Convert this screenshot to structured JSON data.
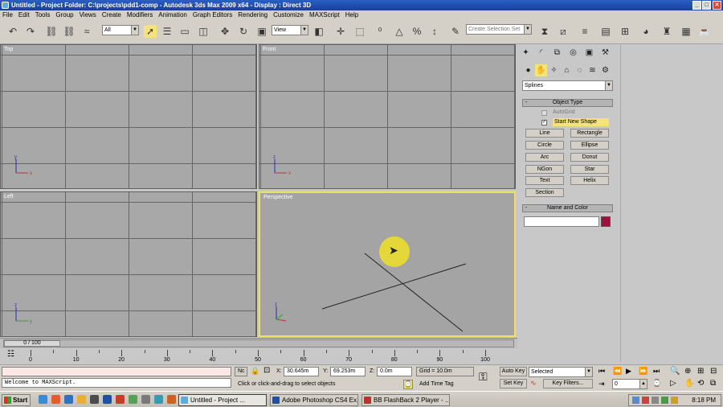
{
  "window": {
    "title": "Untitled    - Project Folder: C:\\projects\\pdd1-comp     - Autodesk 3ds Max  2009 x64     - Display : Direct 3D",
    "min": "_",
    "max": "□",
    "close": "✕"
  },
  "menu": [
    "File",
    "Edit",
    "Tools",
    "Group",
    "Views",
    "Create",
    "Modifiers",
    "Animation",
    "Graph Editors",
    "Rendering",
    "Customize",
    "MAXScript",
    "Help"
  ],
  "toolbar": {
    "filter_select": "All",
    "ref_coord": "View",
    "selection_set_placeholder": "Create Selection Set"
  },
  "viewports": {
    "top": "Top",
    "front": "Front",
    "left": "Left",
    "perspective": "Perspective",
    "axis_x": "x",
    "axis_y": "y",
    "axis_z": "z"
  },
  "command_panel": {
    "category_select": "Splines",
    "object_type_title": "Object Type",
    "autogrid_label": "AutoGrid",
    "start_new_shape_label": "Start New Shape",
    "buttons": [
      "Line",
      "Rectangle",
      "Circle",
      "Ellipse",
      "Arc",
      "Donut",
      "NGon",
      "Star",
      "Text",
      "Helix",
      "Section"
    ],
    "name_color_title": "Name and Color",
    "color": "#a0103c",
    "minus": "-"
  },
  "timeline": {
    "frame_counter": "0 / 100",
    "ticks": [
      "0",
      "10",
      "20",
      "30",
      "40",
      "50",
      "60",
      "70",
      "80",
      "90",
      "100"
    ]
  },
  "status": {
    "maxscript": "Welcome to MAXScript.",
    "hint": "Click or click-and-drag to select objects",
    "none_selected": "Nc",
    "x_label": "X:",
    "x_value": "30.645m",
    "y_label": "Y:",
    "y_value": "69.253m",
    "z_label": "Z:",
    "z_value": "0.0m",
    "grid": "Grid = 10.0m",
    "add_time_tag": "Add Time Tag",
    "auto_key": "Auto Key",
    "set_key": "Set Key",
    "selected_select": "Selected",
    "key_filters": "Key Filters...",
    "frame_field": "0"
  },
  "taskbar": {
    "start": "Start",
    "tasks": [
      "Untitled    - Project ...",
      "Adobe Photoshop CS4 Ex...",
      "BB FlashBack 2 Player - ..."
    ],
    "clock": "8:18 PM"
  }
}
